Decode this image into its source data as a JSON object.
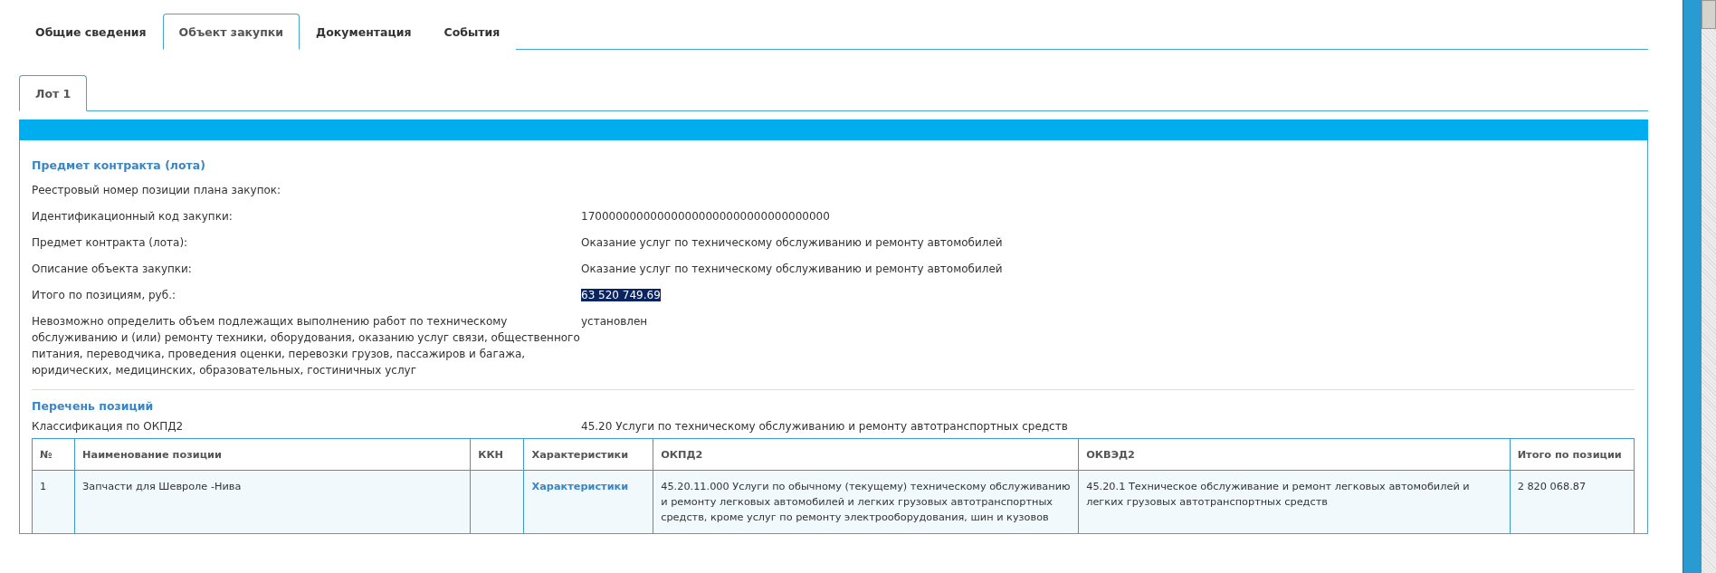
{
  "tabs": [
    {
      "label": "Общие сведения",
      "selected": false
    },
    {
      "label": "Объект закупки",
      "selected": true
    },
    {
      "label": "Документация",
      "selected": false
    },
    {
      "label": "События",
      "selected": false
    }
  ],
  "lot_tabs": [
    {
      "label": "Лот 1",
      "selected": true
    }
  ],
  "section_title": "Предмет контракта (лота)",
  "fields": [
    {
      "label": "Реестровый номер позиции плана закупок:"
    },
    {
      "label": "Идентификационный код закупки:",
      "value": "170000000000000000000000000000000000"
    },
    {
      "label": "Предмет контракта (лота):",
      "value": "Оказание услуг по техническому обслуживанию и ремонту автомобилей"
    },
    {
      "label": "Описание объекта закупки:",
      "value": "Оказание услуг по техническому обслуживанию и ремонту автомобилей"
    },
    {
      "label": "Итого по позициям, руб.:",
      "value": "63 520 749.69",
      "highlighted": true
    },
    {
      "label": "Невозможно определить объем подлежащих выполнению работ по техническому обслуживанию и (или) ремонту техники, оборудования, оказанию услуг связи, общественного питания, переводчика, проведения оценки, перевозки грузов, пассажиров и багажа, юридических, медицинских, образовательных, гостиничных услуг",
      "value": "установлен"
    }
  ],
  "positions_title": "Перечень позиций",
  "classification": {
    "label": "Классификация по ОКПД2",
    "value": "45.20 Услуги по техническому обслуживанию и ремонту автотранспортных средств"
  },
  "table": {
    "columns": [
      "№",
      "Наименование позиции",
      "ККН",
      "Характеристики",
      "ОКПД2",
      "ОКВЭД2",
      "Итого по позиции"
    ],
    "rows": [
      {
        "cells": [
          "1",
          "Запчасти для Шевроле -Нива",
          "",
          "Характеристики",
          "45.20.11.000 Услуги по обычному (текущему) техническому обслуживанию и ремонту легковых автомобилей и легких грузовых автотранспортных средств, кроме услуг по ремонту электрооборудования, шин и кузовов",
          "45.20.1 Техническое обслуживание и ремонт легковых автомобилей и легких грузовых автотранспортных средств",
          "2 820 068.87"
        ]
      }
    ]
  }
}
